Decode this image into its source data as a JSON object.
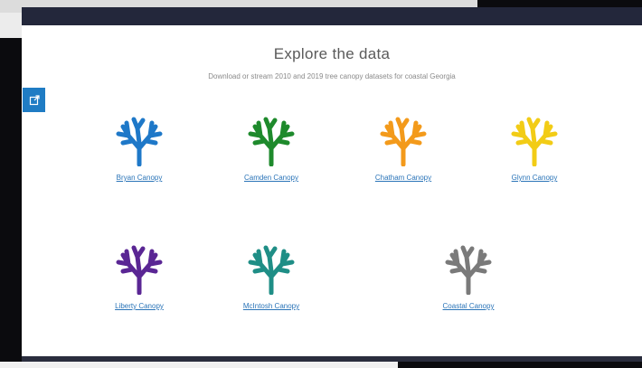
{
  "page": {
    "title": "Explore the data",
    "subtitle": "Download or stream 2010 and 2019 tree canopy datasets for coastal Georgia"
  },
  "share_button": {
    "icon": "share-icon"
  },
  "datasets": [
    {
      "label": "Bryan Canopy",
      "color": "#1e78c8",
      "icon": "tree-canopy-icon"
    },
    {
      "label": "Camden Canopy",
      "color": "#1e8a2c",
      "icon": "tree-canopy-icon"
    },
    {
      "label": "Chatham Canopy",
      "color": "#f39a1b",
      "icon": "tree-canopy-icon"
    },
    {
      "label": "Glynn Canopy",
      "color": "#f2cc16",
      "icon": "tree-canopy-icon"
    },
    {
      "label": "Liberty Canopy",
      "color": "#5a2694",
      "icon": "tree-canopy-icon"
    },
    {
      "label": "McIntosh Canopy",
      "color": "#1f8e86",
      "icon": "tree-canopy-icon"
    },
    {
      "label": "Coastal Canopy",
      "color": "#7a7a7a",
      "icon": "tree-canopy-icon"
    }
  ]
}
